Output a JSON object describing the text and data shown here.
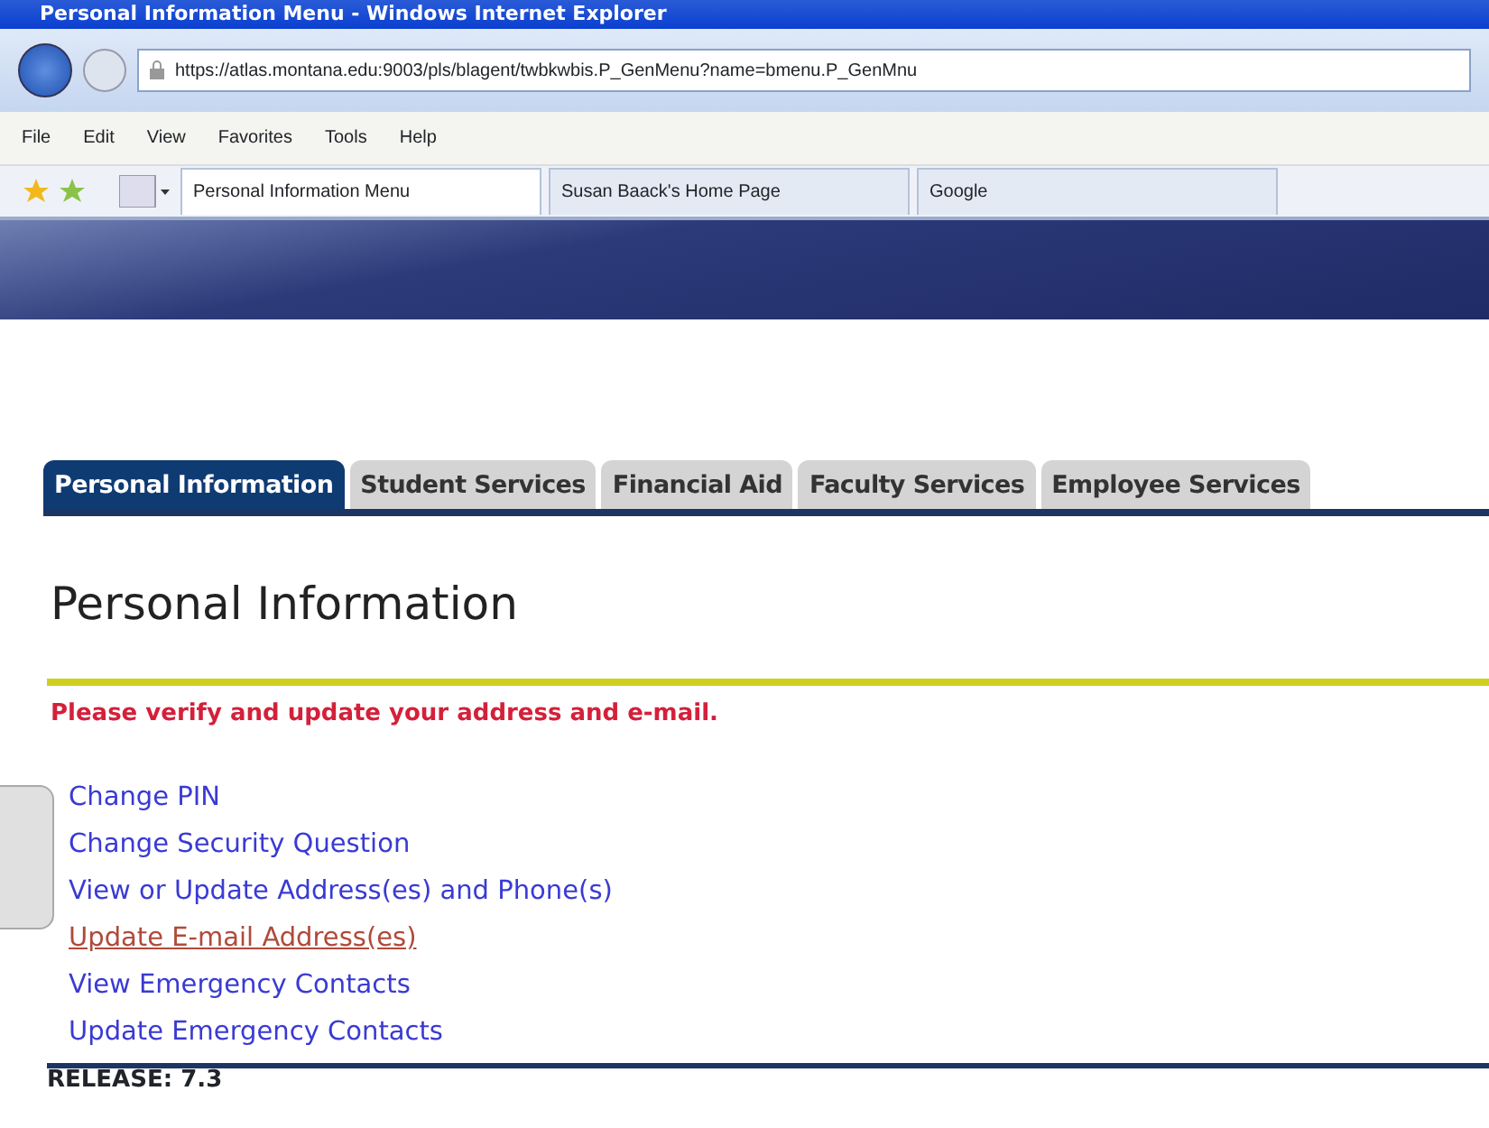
{
  "window": {
    "title": "Personal Information Menu - Windows Internet Explorer"
  },
  "address_bar": {
    "url": "https://atlas.montana.edu:9003/pls/blagent/twbkwbis.P_GenMenu?name=bmenu.P_GenMnu"
  },
  "menu_bar": [
    "File",
    "Edit",
    "View",
    "Favorites",
    "Tools",
    "Help"
  ],
  "browser_tabs": [
    {
      "label": "Personal Information Menu",
      "selected": true
    },
    {
      "label": "Susan Baack's Home Page",
      "selected": false
    },
    {
      "label": "Google",
      "selected": false
    }
  ],
  "site_tabs": [
    {
      "label": "Personal Information",
      "selected": true
    },
    {
      "label": "Student Services",
      "selected": false
    },
    {
      "label": "Financial Aid",
      "selected": false
    },
    {
      "label": "Faculty Services",
      "selected": false
    },
    {
      "label": "Employee Services",
      "selected": false
    }
  ],
  "heading": "Personal Information",
  "notice": "Please verify and update your address and e-mail.",
  "links": [
    {
      "label": "Change PIN",
      "hovered": false
    },
    {
      "label": "Change Security Question",
      "hovered": false
    },
    {
      "label": "View or Update Address(es) and Phone(s)",
      "hovered": false
    },
    {
      "label": "Update E-mail Address(es)",
      "hovered": true
    },
    {
      "label": "View Emergency Contacts",
      "hovered": false
    },
    {
      "label": "Update Emergency Contacts",
      "hovered": false
    }
  ],
  "footer": "RELEASE: 7.3"
}
